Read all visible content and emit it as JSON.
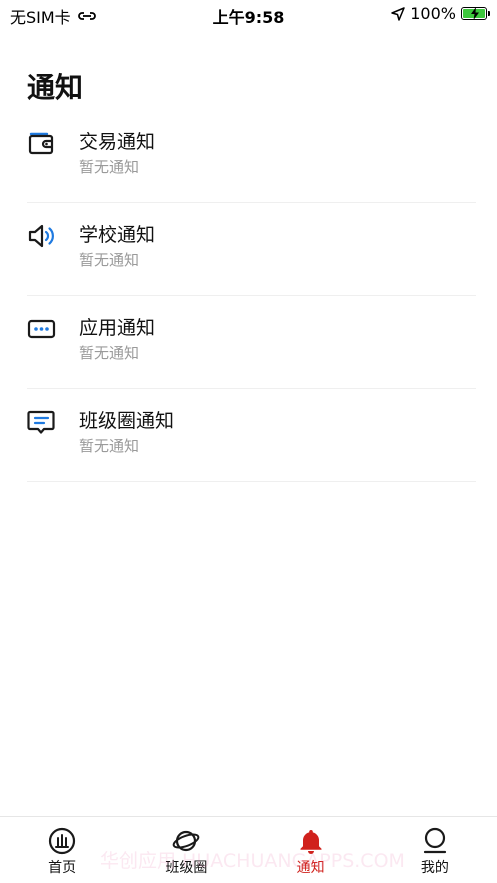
{
  "status_bar": {
    "carrier": "无SIM卡",
    "time": "上午9:58",
    "battery": "100%"
  },
  "page": {
    "title": "通知"
  },
  "notices": [
    {
      "title": "交易通知",
      "subtitle": "暂无通知",
      "icon": "wallet-icon"
    },
    {
      "title": "学校通知",
      "subtitle": "暂无通知",
      "icon": "speaker-icon"
    },
    {
      "title": "应用通知",
      "subtitle": "暂无通知",
      "icon": "app-dots-icon"
    },
    {
      "title": "班级圈通知",
      "subtitle": "暂无通知",
      "icon": "message-icon"
    }
  ],
  "tabs": [
    {
      "label": "首页",
      "icon": "home-icon",
      "active": false
    },
    {
      "label": "班级圈",
      "icon": "planet-icon",
      "active": false
    },
    {
      "label": "通知",
      "icon": "bell-icon",
      "active": true
    },
    {
      "label": "我的",
      "icon": "profile-icon",
      "active": false
    }
  ],
  "watermark": "华创应用 HUACHUANGAPPS.COM",
  "colors": {
    "accent": "#d0211c",
    "icon_blue": "#1f7ae0",
    "subtitle_gray": "#9a9a9a"
  }
}
